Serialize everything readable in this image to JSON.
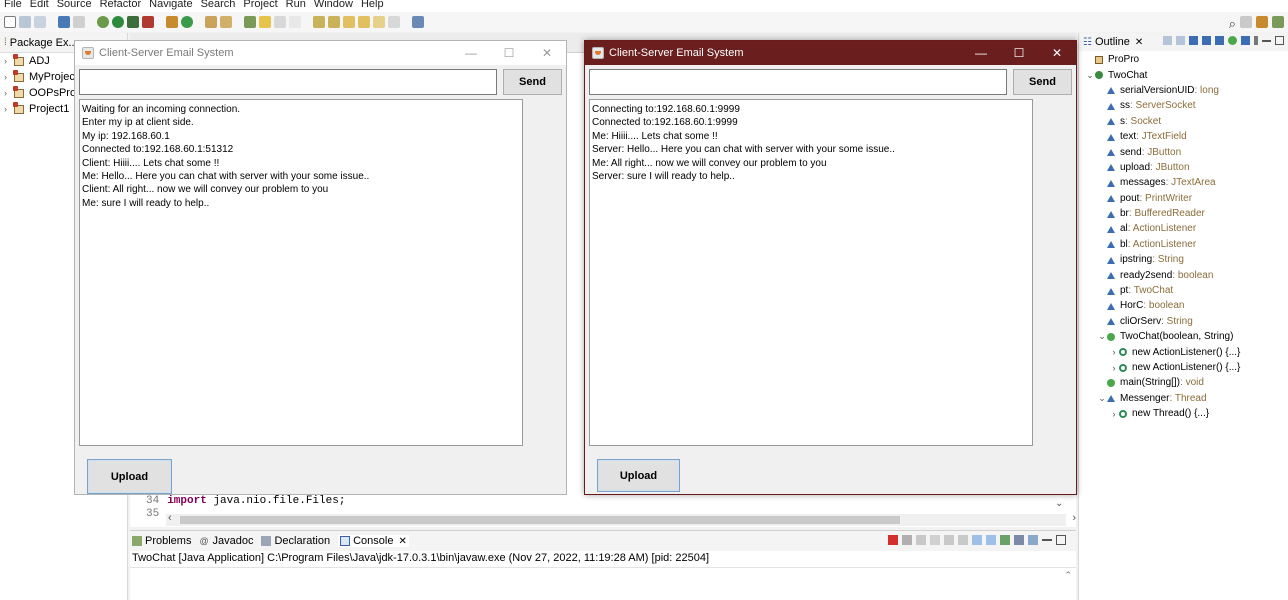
{
  "menubar": [
    "File",
    "Edit",
    "Source",
    "Refactor",
    "Navigate",
    "Search",
    "Project",
    "Run",
    "Window",
    "Help"
  ],
  "package_explorer": {
    "tab_label": "Package Ex...",
    "projects": [
      "ADJ",
      "MyProject",
      "OOPsProje",
      "Project1"
    ]
  },
  "editor": {
    "line_number": "34",
    "keyword": "import",
    "code": " java.nio.file.Files;",
    "cut_line": "35"
  },
  "console": {
    "tabs": [
      "Problems",
      "Javadoc",
      "Declaration",
      "Console"
    ],
    "description": "TwoChat [Java Application] C:\\Program Files\\Java\\jdk-17.0.3.1\\bin\\javaw.exe  (Nov 27, 2022, 11:19:28 AM) [pid: 22504]"
  },
  "outline": {
    "tab_label": "Outline",
    "items": [
      {
        "name": "ProPro",
        "type": "",
        "icon": "package",
        "depth": 0,
        "arrow": ""
      },
      {
        "name": "TwoChat",
        "type": "",
        "icon": "class",
        "depth": 0,
        "arrow": "v"
      },
      {
        "name": "serialVersionUID",
        "type": " : long",
        "icon": "field",
        "depth": 1,
        "arrow": ""
      },
      {
        "name": "ss",
        "type": " : ServerSocket",
        "icon": "field",
        "depth": 1,
        "arrow": ""
      },
      {
        "name": "s",
        "type": " : Socket",
        "icon": "field",
        "depth": 1,
        "arrow": ""
      },
      {
        "name": "text",
        "type": " : JTextField",
        "icon": "field",
        "depth": 1,
        "arrow": ""
      },
      {
        "name": "send",
        "type": " : JButton",
        "icon": "field",
        "depth": 1,
        "arrow": ""
      },
      {
        "name": "upload",
        "type": " : JButton",
        "icon": "field",
        "depth": 1,
        "arrow": ""
      },
      {
        "name": "messages",
        "type": " : JTextArea",
        "icon": "field",
        "depth": 1,
        "arrow": ""
      },
      {
        "name": "pout",
        "type": " : PrintWriter",
        "icon": "field",
        "depth": 1,
        "arrow": ""
      },
      {
        "name": "br",
        "type": " : BufferedReader",
        "icon": "field",
        "depth": 1,
        "arrow": ""
      },
      {
        "name": "al",
        "type": " : ActionListener",
        "icon": "field",
        "depth": 1,
        "arrow": ""
      },
      {
        "name": "bl",
        "type": " : ActionListener",
        "icon": "field",
        "depth": 1,
        "arrow": ""
      },
      {
        "name": "ipstring",
        "type": " : String",
        "icon": "field",
        "depth": 1,
        "arrow": ""
      },
      {
        "name": "ready2send",
        "type": " : boolean",
        "icon": "field",
        "depth": 1,
        "arrow": ""
      },
      {
        "name": "pt",
        "type": " : TwoChat",
        "icon": "field",
        "depth": 1,
        "arrow": ""
      },
      {
        "name": "HorC",
        "type": " : boolean",
        "icon": "field",
        "depth": 1,
        "arrow": ""
      },
      {
        "name": "cliOrServ",
        "type": " : String",
        "icon": "field",
        "depth": 1,
        "arrow": ""
      },
      {
        "name": "TwoChat(boolean, String)",
        "type": "",
        "icon": "method",
        "depth": 1,
        "arrow": "v"
      },
      {
        "name": "new ActionListener() {...}",
        "type": "",
        "icon": "anon",
        "depth": 2,
        "arrow": ">"
      },
      {
        "name": "new ActionListener() {...}",
        "type": "",
        "icon": "anon",
        "depth": 2,
        "arrow": ">"
      },
      {
        "name": "main(String[])",
        "type": " : void",
        "icon": "method",
        "depth": 1,
        "arrow": ""
      },
      {
        "name": "Messenger",
        "type": " : Thread",
        "icon": "field",
        "depth": 1,
        "arrow": "v"
      },
      {
        "name": "new Thread() {...}",
        "type": "",
        "icon": "anon",
        "depth": 2,
        "arrow": ">"
      }
    ]
  },
  "window_server": {
    "title": "Client-Server Email System",
    "send_label": "Send",
    "upload_label": "Upload",
    "messages": [
      "Waiting for an incoming connection.",
      "Enter my ip at client side.",
      "My ip: 192.168.60.1",
      "Connected to:192.168.60.1:51312",
      "Client: Hiiii.... Lets chat some !!",
      "Me: Hello... Here you can chat with server with your some issue..",
      "Client: All right... now we will convey our problem to you",
      "Me: sure I will ready to help.."
    ]
  },
  "window_client": {
    "title": "Client-Server Email System",
    "send_label": "Send",
    "upload_label": "Upload",
    "messages": [
      "Connecting to:192.168.60.1:9999",
      "Connected to:192.168.60.1:9999",
      "Me: Hiiii.... Lets chat some !!",
      "Server: Hello... Here you can chat with server with your some issue..",
      "Me: All right... now we will convey our problem to you",
      "Server: sure I will ready to help.."
    ]
  },
  "colors": {
    "active_titlebar": "#6b1e1e",
    "type_text": "#8a6d3b",
    "keyword": "#7f0055"
  }
}
